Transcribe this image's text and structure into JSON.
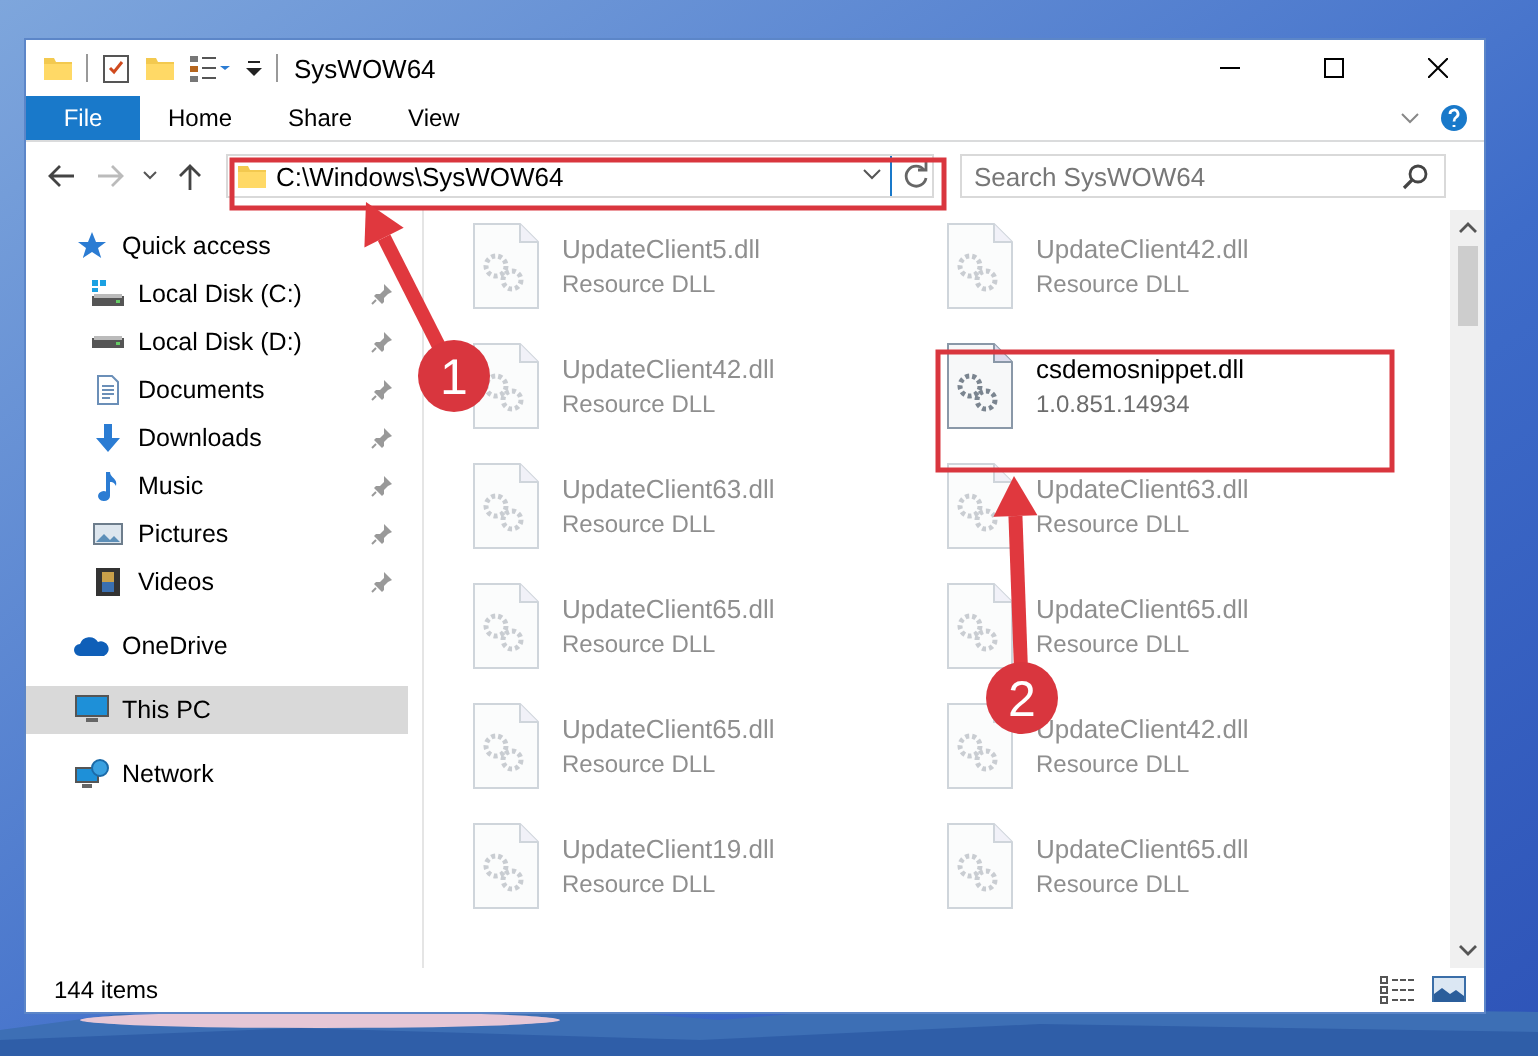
{
  "window": {
    "title": "SysWOW64"
  },
  "ribbon": {
    "tabs": [
      {
        "label": "File",
        "kind": "file"
      },
      {
        "label": "Home",
        "kind": "tab"
      },
      {
        "label": "Share",
        "kind": "tab"
      },
      {
        "label": "View",
        "kind": "tab"
      }
    ]
  },
  "address": {
    "path": "C:\\Windows\\SysWOW64"
  },
  "search": {
    "placeholder": "Search SysWOW64"
  },
  "sidebar": {
    "items": [
      {
        "label": "Quick access",
        "pinned": false,
        "selected": false,
        "children": [
          {
            "label": "Local Disk (C:)",
            "pinned": true,
            "selected": false
          },
          {
            "label": "Local Disk (D:)",
            "pinned": true,
            "selected": false
          },
          {
            "label": "Documents",
            "pinned": true,
            "selected": false
          },
          {
            "label": "Downloads",
            "pinned": true,
            "selected": false
          },
          {
            "label": "Music",
            "pinned": true,
            "selected": false
          },
          {
            "label": "Pictures",
            "pinned": true,
            "selected": false
          },
          {
            "label": "Videos",
            "pinned": true,
            "selected": false
          }
        ]
      },
      {
        "label": "OneDrive",
        "pinned": false,
        "selected": false
      },
      {
        "label": "This PC",
        "pinned": false,
        "selected": true
      },
      {
        "label": "Network",
        "pinned": false,
        "selected": false
      }
    ]
  },
  "files": [
    {
      "name": "UpdateClient5.dll",
      "detail": "Resource DLL",
      "faded": true
    },
    {
      "name": "UpdateClient42.dll",
      "detail": "Resource DLL",
      "faded": true
    },
    {
      "name": "UpdateClient42.dll",
      "detail": "Resource DLL",
      "faded": true
    },
    {
      "name": "csdemosnippet.dll",
      "detail": "1.0.851.14934",
      "faded": false
    },
    {
      "name": "UpdateClient63.dll",
      "detail": "Resource DLL",
      "faded": true
    },
    {
      "name": "UpdateClient63.dll",
      "detail": "Resource DLL",
      "faded": true
    },
    {
      "name": "UpdateClient65.dll",
      "detail": "Resource DLL",
      "faded": true
    },
    {
      "name": "UpdateClient65.dll",
      "detail": "Resource DLL",
      "faded": true
    },
    {
      "name": "UpdateClient65.dll",
      "detail": "Resource DLL",
      "faded": true
    },
    {
      "name": "UpdateClient42.dll",
      "detail": "Resource DLL",
      "faded": true
    },
    {
      "name": "UpdateClient19.dll",
      "detail": "Resource DLL",
      "faded": true
    },
    {
      "name": "UpdateClient65.dll",
      "detail": "Resource DLL",
      "faded": true
    }
  ],
  "status_bar": {
    "count": "144 items"
  },
  "annotations": [
    {
      "label": "1"
    },
    {
      "label": "2"
    }
  ]
}
